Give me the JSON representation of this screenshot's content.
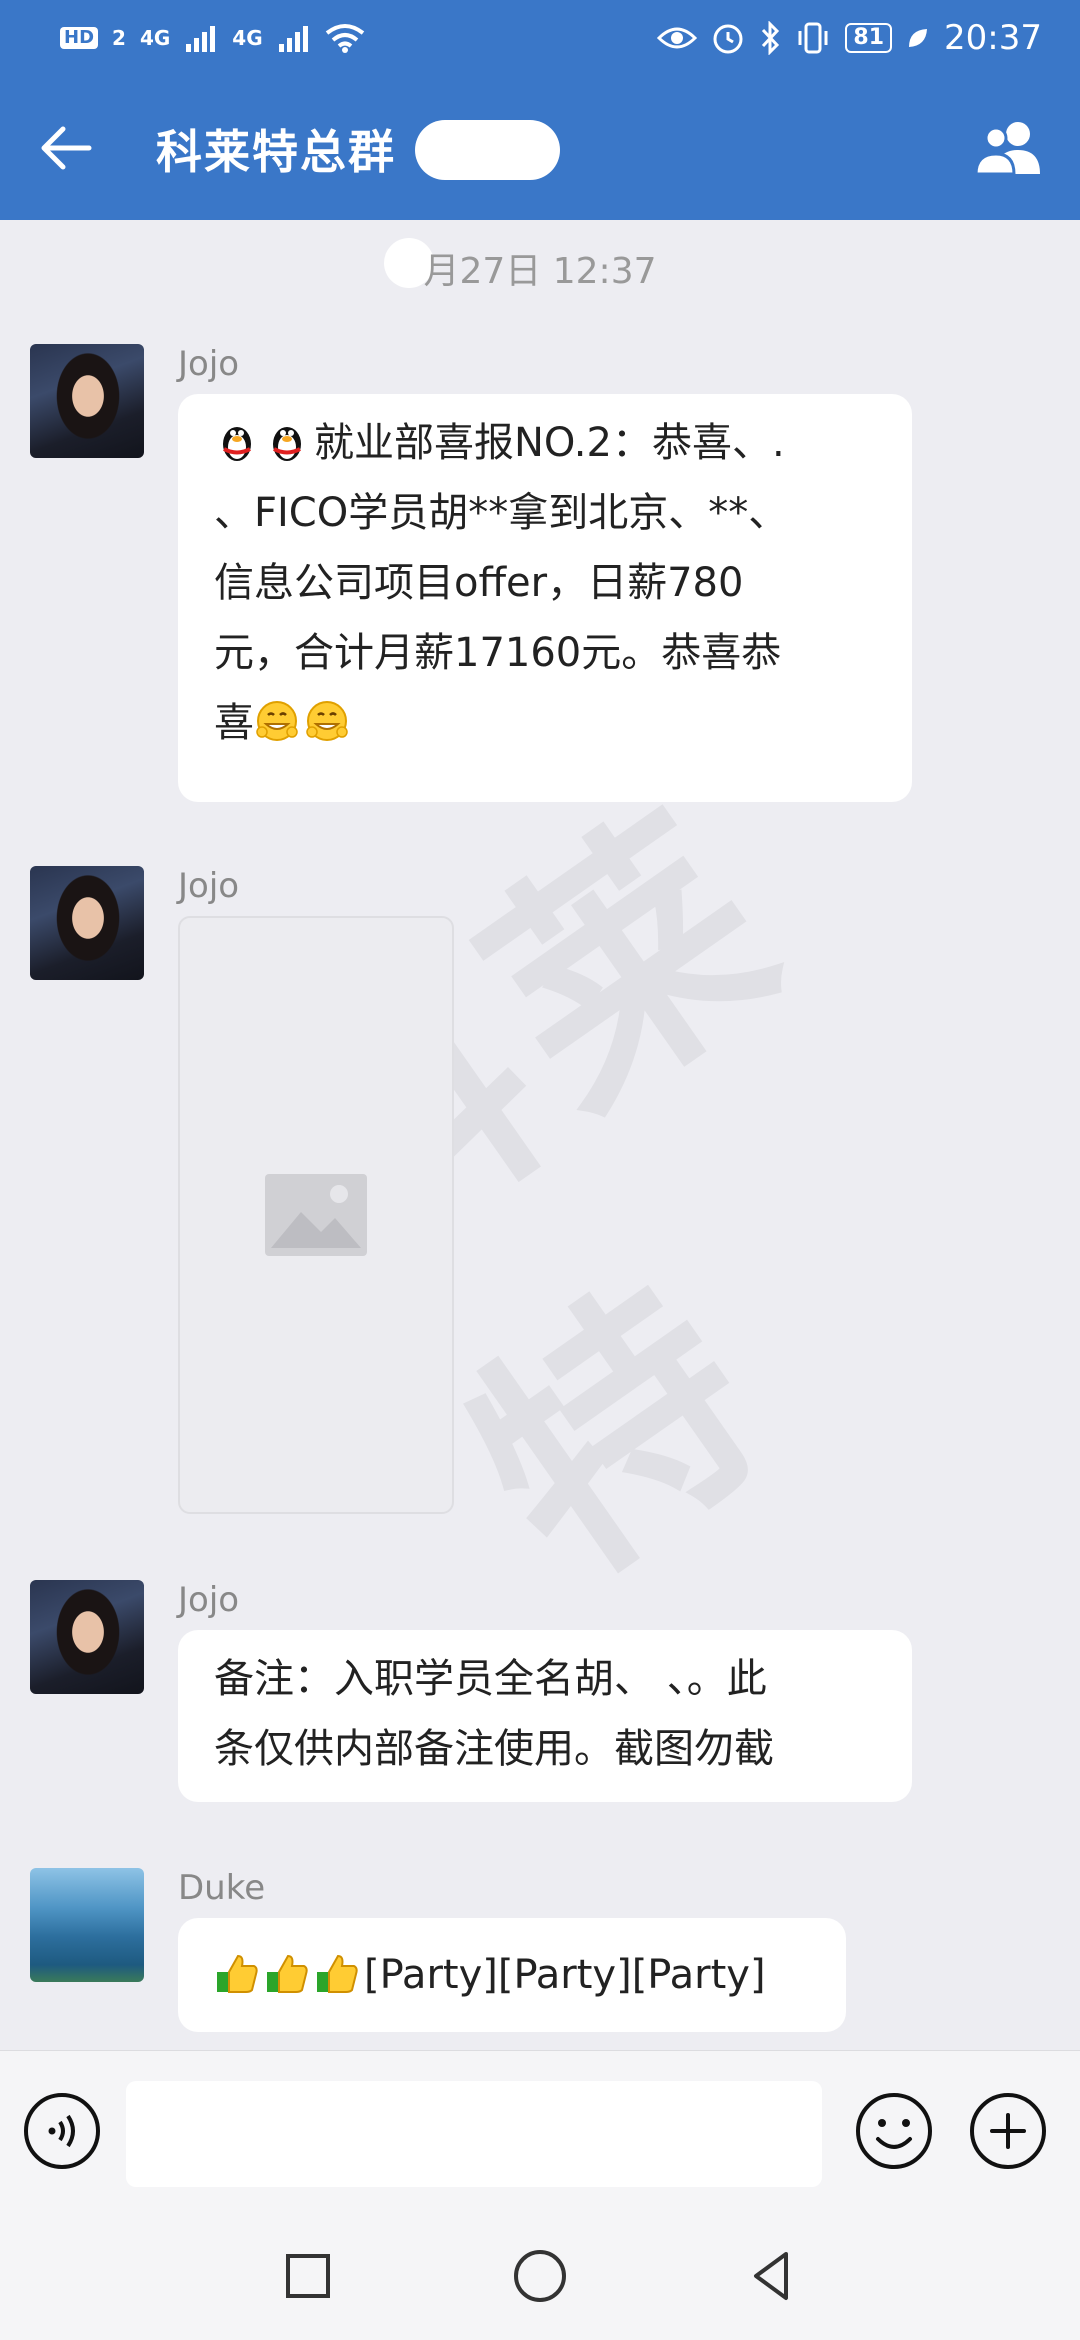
{
  "status_bar": {
    "hd": "HD",
    "sim": "2",
    "net1": "4G",
    "net2": "4G",
    "battery": "81",
    "time": "20:37"
  },
  "header": {
    "title": "科莱特总群"
  },
  "chat": {
    "timestamp": "月27日  12:37",
    "watermark": "科莱特",
    "messages": [
      {
        "sender": "Jojo",
        "lines": [
          "就业部喜报NO.2：恭喜、.",
          "、FICO学员胡**拿到北京、**、",
          "信息公司项目offer，日薪780",
          "元，合计月薪17160元。恭喜恭",
          "喜"
        ]
      },
      {
        "sender": "Jojo"
      },
      {
        "sender": "Jojo",
        "lines": [
          "备注：入职学员全名胡、 、。此",
          "条仅供内部备注使用。截图勿截"
        ]
      },
      {
        "sender": "Duke",
        "text": "[Party][Party][Party]"
      }
    ]
  },
  "input": {
    "placeholder": ""
  },
  "colors": {
    "brand": "#3a77c8",
    "background": "#ededf2",
    "bubble": "#ffffff"
  },
  "icons": {
    "back": "arrow-left-icon",
    "members": "group-members-icon",
    "voice": "voice-icon",
    "emoji": "emoji-icon",
    "plus": "plus-icon",
    "image": "image-placeholder-icon",
    "penguin": "qq-penguin-icon",
    "grin": "grin-emoji-icon",
    "thumbs": "thumbs-up-icon"
  }
}
